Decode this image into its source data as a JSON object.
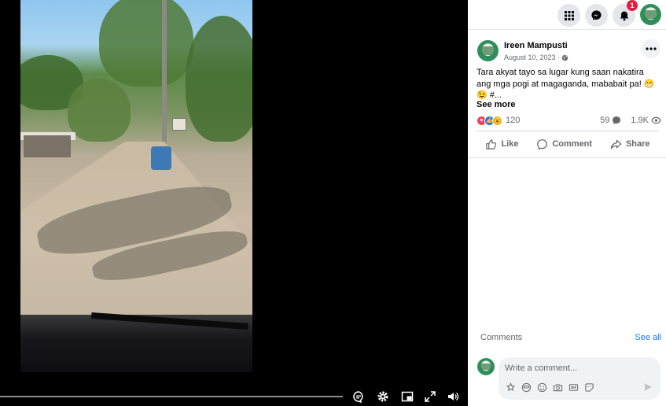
{
  "topbar": {
    "apps_icon": "grid-icon",
    "messenger_icon": "messenger-icon",
    "notifications_icon": "bell-icon",
    "notification_count": "1",
    "profile_avatar": "avatar"
  },
  "post": {
    "author": "Ireen Mampusti",
    "date": "August 10, 2023 ·",
    "privacy_icon": "globe-icon",
    "text": "Tara akyat tayo sa lugar kung saan nakatira ang mga pogi at magaganda, mababait pa! 😁😉 #...",
    "see_more": "See more",
    "reaction_count": "120",
    "comment_count": "59",
    "view_count": "1.9K"
  },
  "actions": {
    "like": "Like",
    "comment": "Comment",
    "share": "Share"
  },
  "comments": {
    "label": "Comments",
    "see_all": "See all",
    "placeholder": "Write a comment..."
  },
  "video_controls": {
    "icons": [
      "captions-icon",
      "settings-icon",
      "pip-icon",
      "fullscreen-icon",
      "volume-icon"
    ]
  },
  "colors": {
    "accent": "#1877f2",
    "notification_badge": "#e41e3f"
  }
}
